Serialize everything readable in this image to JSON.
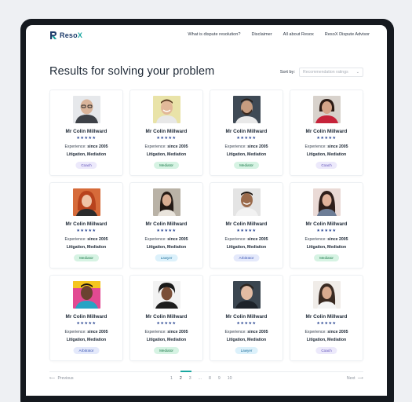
{
  "brand": {
    "name_main": "Reso",
    "name_accent": "X",
    "accent_color": "#1aa7a1",
    "primary_color": "#1d3b6a"
  },
  "nav": {
    "links": [
      "What is dispute resolution?",
      "Disclaimer",
      "All about Resox",
      "ResoX Dispute Advisor"
    ]
  },
  "page": {
    "title": "Results for solving your problem",
    "sort_label": "Sort by:",
    "sort_placeholder": "Recommendation ratings"
  },
  "cards": [
    {
      "name": "Mr Colin Millward",
      "stars": "★★★★★",
      "experience_label": "Experience:",
      "experience_value": "since 2005",
      "specialties": "Litigation, Mediation",
      "role": "Coach",
      "avatar": "bald-man-glasses-avatar"
    },
    {
      "name": "Mr Colin Millward",
      "stars": "★★★★★",
      "experience_label": "Experience:",
      "experience_value": "since 2005",
      "specialties": "Litigation, Mediation",
      "role": "Mediator",
      "avatar": "smiling-man-avatar"
    },
    {
      "name": "Mr Colin Millward",
      "stars": "★★★★★",
      "experience_label": "Experience:",
      "experience_value": "since 2005",
      "specialties": "Litigation, Mediation",
      "role": "Mediator",
      "avatar": "bearded-man-avatar"
    },
    {
      "name": "Mr Colin Millward",
      "stars": "★★★★★",
      "experience_label": "Experience:",
      "experience_value": "since 2005",
      "specialties": "Litigation, Mediation",
      "role": "Coach",
      "avatar": "woman-red-top-avatar"
    },
    {
      "name": "Mr Colin Millward",
      "stars": "★★★★★",
      "experience_label": "Experience:",
      "experience_value": "since 2005",
      "specialties": "Litigation, Mediation",
      "role": "Mediator",
      "avatar": "red-haired-woman-avatar"
    },
    {
      "name": "Mr Colin Millward",
      "stars": "★★★★★",
      "experience_label": "Experience:",
      "experience_value": "since 2005",
      "specialties": "Litigation, Mediation",
      "role": "Lawyer",
      "avatar": "dark-haired-woman-avatar"
    },
    {
      "name": "Mr Colin Millward",
      "stars": "★★★★★",
      "experience_label": "Experience:",
      "experience_value": "since 2005",
      "specialties": "Litigation, Mediation",
      "role": "Arbitrator",
      "avatar": "smiling-man-avatar-2"
    },
    {
      "name": "Mr Colin Millward",
      "stars": "★★★★★",
      "experience_label": "Experience:",
      "experience_value": "since 2005",
      "specialties": "Litigation, Mediation",
      "role": "Mediator",
      "avatar": "woman-long-hair-avatar"
    },
    {
      "name": "Mr Colin Millward",
      "stars": "★★★★★",
      "experience_label": "Experience:",
      "experience_value": "since 2005",
      "specialties": "Litigation, Mediation",
      "role": "Arbitrator",
      "avatar": "man-pink-background-avatar"
    },
    {
      "name": "Mr Colin Millward",
      "stars": "★★★★★",
      "experience_label": "Experience:",
      "experience_value": "since 2005",
      "specialties": "Litigation, Mediation",
      "role": "Mediator",
      "avatar": "man-curly-hair-avatar"
    },
    {
      "name": "Mr Colin Millward",
      "stars": "★★★★★",
      "experience_label": "Experience:",
      "experience_value": "since 2005",
      "specialties": "Litigation, Mediation",
      "role": "Lawyer",
      "avatar": "young-man-avatar"
    },
    {
      "name": "Mr Colin Millward",
      "stars": "★★★★★",
      "experience_label": "Experience:",
      "experience_value": "since 2005",
      "specialties": "Litigation, Mediation",
      "role": "Coach",
      "avatar": "woman-dark-hair-avatar"
    }
  ],
  "pagination": {
    "prev_label": "Previous",
    "next_label": "Next",
    "pages": [
      "1",
      "2",
      "3",
      "...",
      "8",
      "9",
      "10"
    ],
    "current_page": "2"
  },
  "badge_colors": {
    "Coach": "#ece9fb",
    "Mediator": "#d6f3e3",
    "Lawyer": "#dcf1fb",
    "Arbitrator": "#e4e9fb"
  }
}
